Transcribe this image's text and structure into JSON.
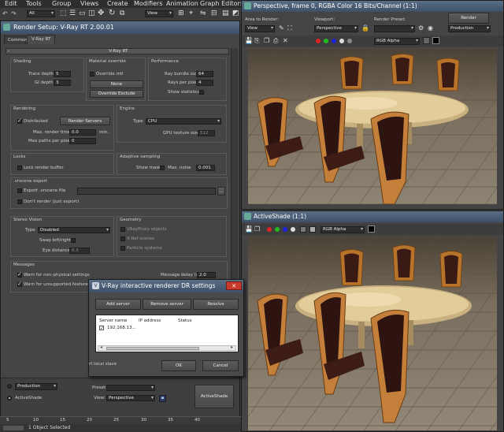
{
  "menu": [
    "Edit",
    "Tools",
    "Group",
    "Views",
    "Create",
    "Modifiers",
    "Animation",
    "Graph Editors"
  ],
  "toolbar": {
    "select_filter": "All",
    "view_dropdown": "View"
  },
  "render_setup": {
    "title": "Render Setup: V-Ray RT 2.00.01",
    "tabs": [
      "Common",
      "V-Ray RT"
    ],
    "rollout_title": "V-Ray RT",
    "shading": {
      "title": "Shading",
      "trace_depth_label": "Trace depth",
      "trace_depth": "5",
      "gi_depth_label": "GI depth",
      "gi_depth": "3"
    },
    "material_override": {
      "title": "Material override",
      "override_label": "Override mtl",
      "none_button": "None",
      "exclude_button": "Override Exclude"
    },
    "performance": {
      "title": "Performance",
      "ray_bundle_label": "Ray bundle size",
      "ray_bundle": "64",
      "rays_per_pixel_label": "Rays per pixel",
      "rays_per_pixel": "4",
      "show_stats_label": "Show statistics"
    },
    "rendering": {
      "title": "Rendering",
      "distributed_label": "Distributed",
      "render_servers_button": "Render Servers",
      "max_render_time_label": "Max. render time",
      "max_render_time": "0.0",
      "min_label": "min.",
      "max_paths_label": "Max paths per pixel",
      "max_paths": "0"
    },
    "engine": {
      "title": "Engine",
      "type_label": "Type",
      "type_value": "CPU",
      "gpu_texture_label": "GPU texture size",
      "gpu_texture": "512"
    },
    "locks": {
      "title": "Locks",
      "lock_buffer_label": "Lock render buffer"
    },
    "adaptive": {
      "title": "Adaptive sampling",
      "show_mask_label": "Show mask",
      "max_noise_label": "Max. noise",
      "max_noise": "0.001"
    },
    "vrscene": {
      "title": ".vrscene export",
      "export_label": "Export .vrscene file",
      "dont_render_label": "Don't render (just export)",
      "browse_button": "..."
    },
    "stereo": {
      "title": "Stereo Vision",
      "type_label": "Type",
      "type_value": "Disabled",
      "swap_label": "Swap left/right",
      "eye_distance_label": "Eye distance",
      "eye_distance": "6.5"
    },
    "geometry": {
      "title": "Geometry",
      "items": [
        "VRayProxy objects",
        "X-Ref scenes",
        "Particle systems"
      ]
    },
    "messages": {
      "title": "Messages",
      "delay_label": "Message delay (s)",
      "delay": "2.0",
      "warn_physical": "Warn for non-physical settings",
      "warn_unsupported": "Warn for unsupported features"
    },
    "bottom": {
      "production_value": "Production",
      "activeshade_label": "ActiveShade",
      "preset_label": "Preset:",
      "preset_value": "",
      "view_label": "View:",
      "view_value": "Perspective",
      "activeshade_button": "ActiveShade"
    }
  },
  "perspective_window": {
    "title": "Perspective, frame 0, RGBA Color 16 Bits/Channel (1:1)",
    "area_label": "Area to Render:",
    "area_value": "View",
    "viewport_label": "Viewport:",
    "viewport_value": "Perspective",
    "preset_label": "Render Preset:",
    "preset_value": "",
    "render_button": "Render",
    "production_value": "Production",
    "channel_value": "RGB Alpha"
  },
  "activeshade_window": {
    "title": "ActiveShade (1:1)",
    "channel_value": "RGB Alpha"
  },
  "dr_dialog": {
    "title": "V-Ray interactive renderer DR settings",
    "add_button": "Add server",
    "remove_button": "Remove server",
    "resolve_button": "Resolve",
    "col_name": "Server name",
    "col_ip": "IP address",
    "col_status": "Status",
    "server_row": "192.168.13...",
    "local_slave_label": "rt local slave",
    "ok_button": "OK",
    "cancel_button": "Cancel"
  },
  "timeline": {
    "ticks": [
      "5",
      "10",
      "15",
      "20",
      "25",
      "30",
      "35",
      "40"
    ]
  },
  "status": {
    "selection": "1 Object Selected"
  },
  "colors": {
    "bg": "#3a3a3a",
    "panel": "#444444",
    "accent": "#1e4f8a",
    "floor": "#8a7e70"
  }
}
